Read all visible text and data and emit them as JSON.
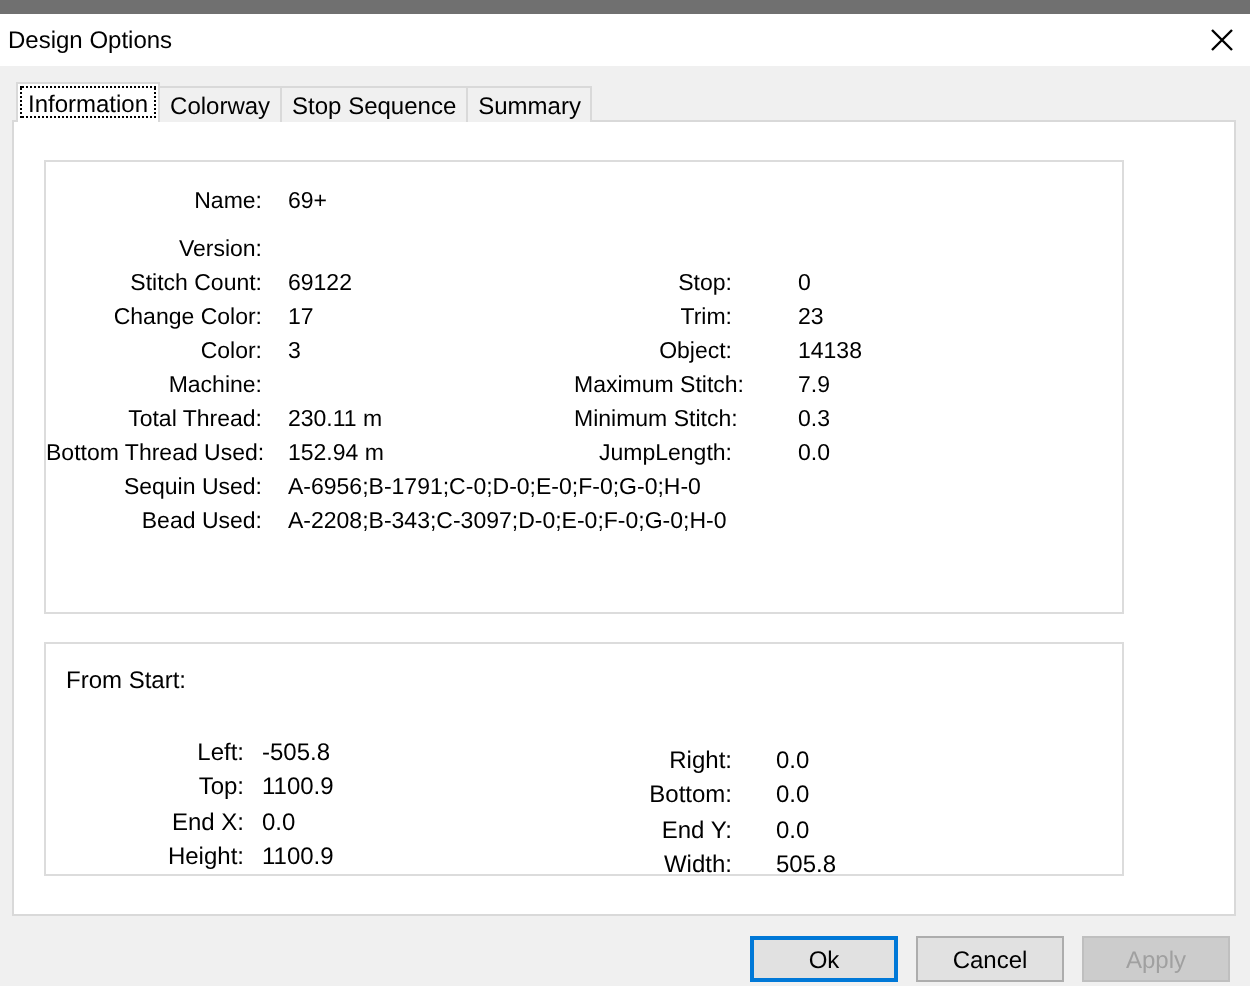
{
  "window": {
    "title": "Design Options"
  },
  "tabs": [
    {
      "label": "Information",
      "selected": true
    },
    {
      "label": "Colorway",
      "selected": false
    },
    {
      "label": "Stop Sequence",
      "selected": false
    },
    {
      "label": "Summary",
      "selected": false
    }
  ],
  "information": {
    "rows": [
      {
        "label": "Name:",
        "value": "69+"
      },
      {
        "label": "Version:",
        "value": ""
      },
      {
        "label": "Stitch Count:",
        "value": "69122",
        "right_label": "Stop:",
        "right_value": "0"
      },
      {
        "label": "Change Color:",
        "value": "17",
        "right_label": "Trim:",
        "right_value": "23"
      },
      {
        "label": "Color:",
        "value": "3",
        "right_label": "Object:",
        "right_value": "14138"
      },
      {
        "label": "Machine:",
        "value": "",
        "right_label": "Maximum Stitch:",
        "right_value": "7.9"
      },
      {
        "label": "Total Thread:",
        "value": "230.11 m",
        "right_label": "Minimum Stitch:",
        "right_value": "0.3"
      },
      {
        "label": "Bottom Thread Used:",
        "value": "152.94 m",
        "right_label": "JumpLength:",
        "right_value": "0.0"
      },
      {
        "label": "Sequin Used:",
        "value": "A-6956;B-1791;C-0;D-0;E-0;F-0;G-0;H-0"
      },
      {
        "label": "Bead Used:",
        "value": "A-2208;B-343;C-3097;D-0;E-0;F-0;G-0;H-0"
      }
    ]
  },
  "from_start": {
    "title": "From Start:",
    "left": [
      {
        "label": "Left:",
        "value": "-505.8"
      },
      {
        "label": "Top:",
        "value": "1100.9"
      },
      {
        "label": "End X:",
        "value": "0.0"
      },
      {
        "label": "Height:",
        "value": "1100.9"
      }
    ],
    "right": [
      {
        "label": "Right:",
        "value": "0.0"
      },
      {
        "label": "Bottom:",
        "value": "0.0"
      },
      {
        "label": "End Y:",
        "value": "0.0"
      },
      {
        "label": "Width:",
        "value": "505.8"
      }
    ]
  },
  "buttons": [
    {
      "label": "Ok",
      "kind": "default",
      "disabled": false
    },
    {
      "label": "Cancel",
      "kind": "normal",
      "disabled": false
    },
    {
      "label": "Apply",
      "kind": "normal",
      "disabled": true
    }
  ]
}
